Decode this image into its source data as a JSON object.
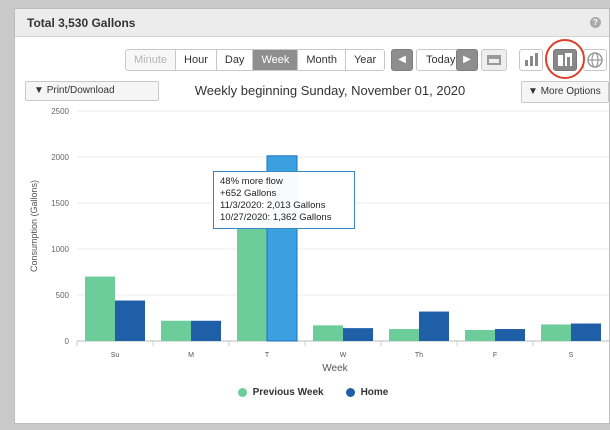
{
  "header": {
    "title": "Total 3,530 Gallons",
    "help_icon": "question-circle-icon"
  },
  "period_buttons": [
    {
      "label": "Minute",
      "state": "disabled"
    },
    {
      "label": "Hour",
      "state": "normal"
    },
    {
      "label": "Day",
      "state": "normal"
    },
    {
      "label": "Week",
      "state": "active"
    },
    {
      "label": "Month",
      "state": "normal"
    },
    {
      "label": "Year",
      "state": "normal"
    }
  ],
  "nav": {
    "prev_icon": "arrow-left-icon",
    "today_label": "Today",
    "next_icon": "arrow-right-icon",
    "calendar_icon": "calendar-icon"
  },
  "view_icons": [
    "bar-chart-icon",
    "compare-chart-icon",
    "globe-icon"
  ],
  "print_label": "Print/Download",
  "more_options_label": "More Options",
  "colors": {
    "previous": "#6ccc9a",
    "home": "#1f5fa8",
    "highlight": "#3aa0e0",
    "tooltip_border": "#3a87c8",
    "annotation_ring": "#d9412b"
  },
  "tooltip": {
    "line1": "48% more flow",
    "line2": "+652 Gallons",
    "line3": "11/3/2020: 2,013 Gallons",
    "line4": "10/27/2020: 1,362 Gallons"
  },
  "legend": {
    "previous_label": "Previous Week",
    "home_label": "Home"
  },
  "chart_data": {
    "type": "bar",
    "title": "Weekly beginning Sunday, November 01, 2020",
    "xlabel": "Week",
    "ylabel": "Consumption (Gallons)",
    "ylim": [
      0,
      2500
    ],
    "yticks": [
      0,
      500,
      1000,
      1500,
      2000,
      2500
    ],
    "categories": [
      "Su",
      "M",
      "T",
      "W",
      "Th",
      "F",
      "S"
    ],
    "series": [
      {
        "name": "Previous Week",
        "values": [
          700,
          220,
          1362,
          170,
          130,
          120,
          180
        ]
      },
      {
        "name": "Home",
        "values": [
          440,
          220,
          2013,
          140,
          320,
          130,
          190
        ]
      }
    ],
    "highlighted": {
      "series": 1,
      "category": 2
    },
    "grid": true,
    "legend_position": "bottom"
  }
}
